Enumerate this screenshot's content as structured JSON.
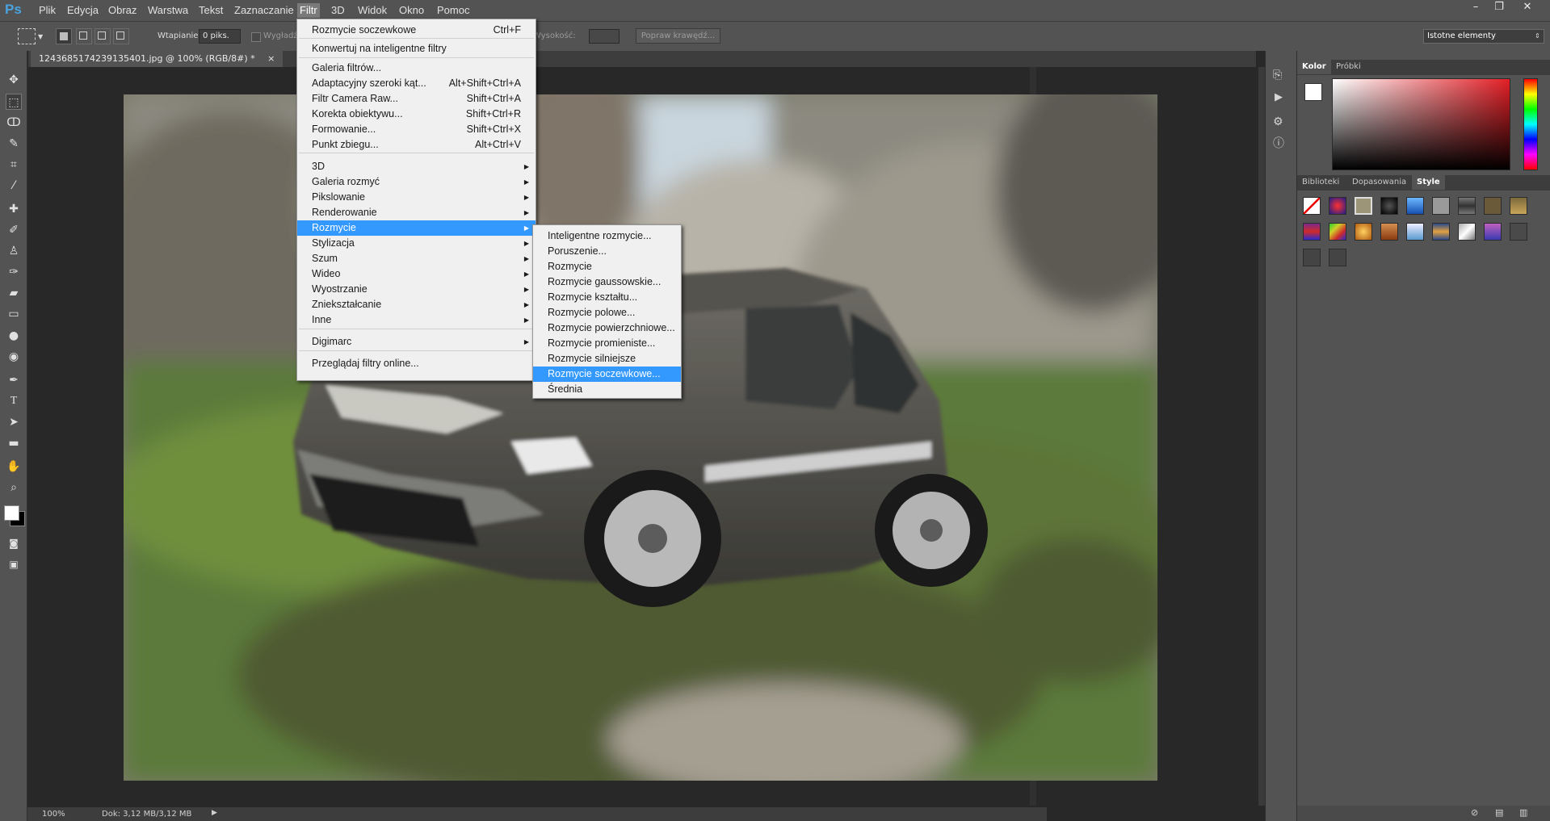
{
  "app": {
    "logo": "Ps"
  },
  "menubar": [
    "Plik",
    "Edycja",
    "Obraz",
    "Warstwa",
    "Tekst",
    "Zaznaczanie",
    "Filtr",
    "3D",
    "Widok",
    "Okno",
    "Pomoc"
  ],
  "window_controls": {
    "minimize": "–",
    "restore": "❐",
    "close": "✕"
  },
  "options": {
    "feather_label": "Wtapianie:",
    "feather_value": "0 piks.",
    "antialias_label": "Wygładź",
    "height_label": "Wysokość:",
    "refine_edge": "Popraw krawędź...",
    "workspace": "Istotne elementy"
  },
  "document_tab": {
    "title": "1243685174239135401.jpg @ 100% (RGB/8#) *",
    "close": "×"
  },
  "status": {
    "zoom": "100%",
    "doc": "Dok: 3,12 MB/3,12 MB"
  },
  "panels": {
    "color_tabs": [
      "Kolor",
      "Próbki"
    ],
    "style_tabs": [
      "Biblioteki",
      "Dopasowania",
      "Style"
    ]
  },
  "filter_menu": {
    "items": [
      {
        "label": "Rozmycie soczewkowe",
        "shortcut": "Ctrl+F"
      },
      {
        "label": "Konwertuj na inteligentne filtry",
        "shortcut": ""
      },
      {
        "label": "Galeria filtrów...",
        "shortcut": ""
      },
      {
        "label": "Adaptacyjny szeroki kąt...",
        "shortcut": "Alt+Shift+Ctrl+A"
      },
      {
        "label": "Filtr Camera Raw...",
        "shortcut": "Shift+Ctrl+A"
      },
      {
        "label": "Korekta obiektywu...",
        "shortcut": "Shift+Ctrl+R"
      },
      {
        "label": "Formowanie...",
        "shortcut": "Shift+Ctrl+X"
      },
      {
        "label": "Punkt zbiegu...",
        "shortcut": "Alt+Ctrl+V"
      },
      {
        "label": "3D",
        "shortcut": ""
      },
      {
        "label": "Galeria rozmyć",
        "shortcut": ""
      },
      {
        "label": "Pikslowanie",
        "shortcut": ""
      },
      {
        "label": "Renderowanie",
        "shortcut": ""
      },
      {
        "label": "Rozmycie",
        "shortcut": ""
      },
      {
        "label": "Stylizacja",
        "shortcut": ""
      },
      {
        "label": "Szum",
        "shortcut": ""
      },
      {
        "label": "Wideo",
        "shortcut": ""
      },
      {
        "label": "Wyostrzanie",
        "shortcut": ""
      },
      {
        "label": "Zniekształcanie",
        "shortcut": ""
      },
      {
        "label": "Inne",
        "shortcut": ""
      },
      {
        "label": "Digimarc",
        "shortcut": ""
      },
      {
        "label": "Przeglądaj filtry online...",
        "shortcut": ""
      }
    ]
  },
  "blur_submenu": {
    "items": [
      "Inteligentne rozmycie...",
      "Poruszenie...",
      "Rozmycie",
      "Rozmycie gaussowskie...",
      "Rozmycie kształtu...",
      "Rozmycie polowe...",
      "Rozmycie powierzchniowe...",
      "Rozmycie promieniste...",
      "Rozmycie silniejsze",
      "Rozmycie soczewkowe...",
      "Średnia"
    ]
  },
  "colors": {
    "menu_highlight": "#3399ff",
    "ui_gray": "#535353",
    "dark": "#282828"
  }
}
